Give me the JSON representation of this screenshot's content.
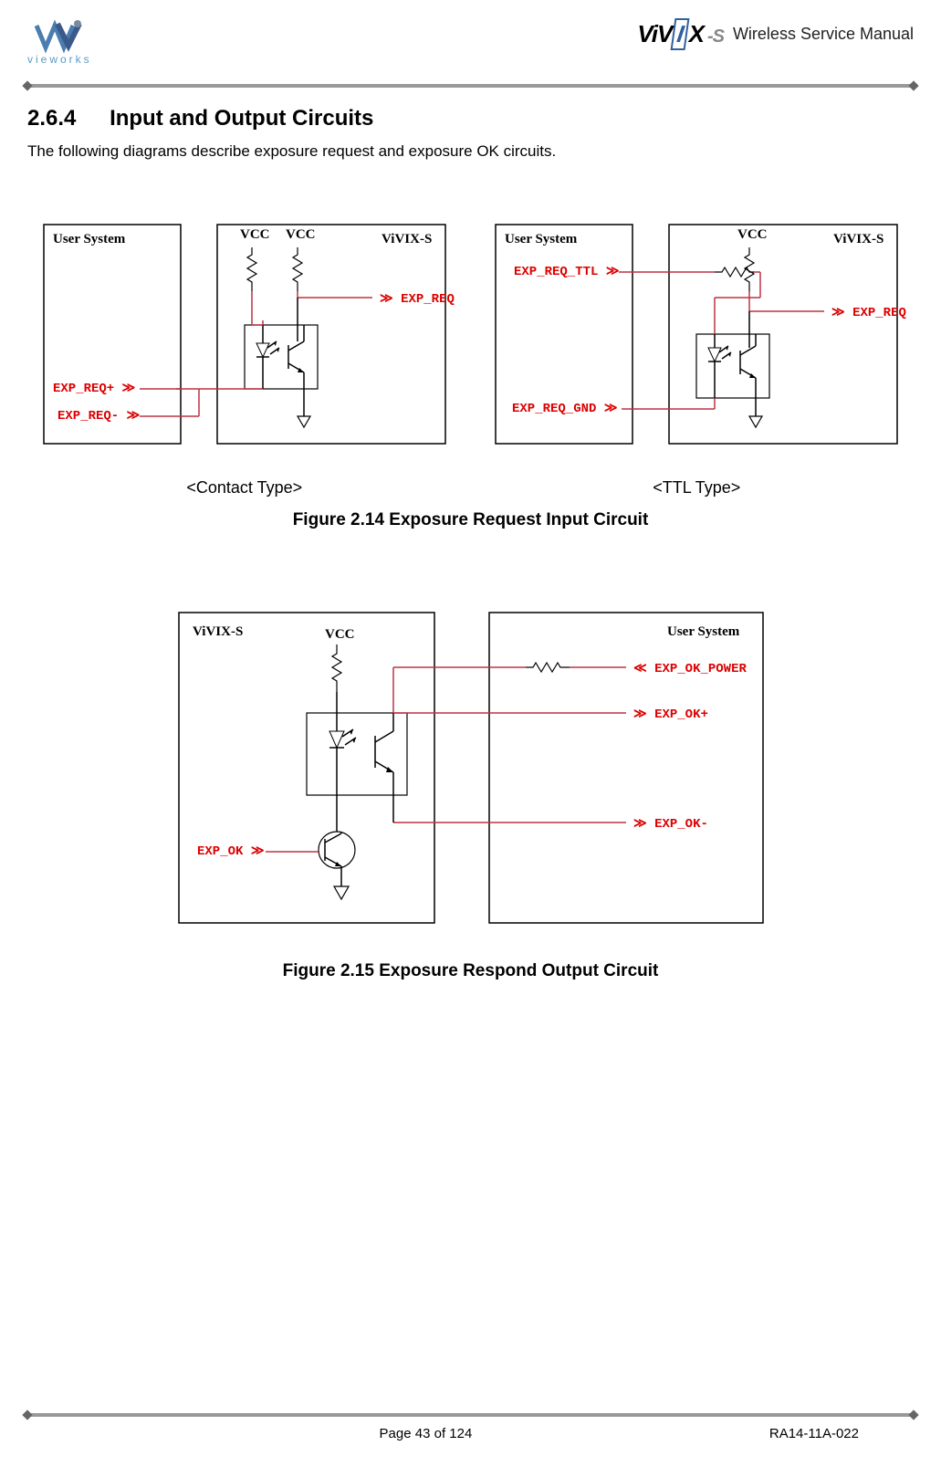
{
  "header": {
    "brand_text": "vieworks",
    "product_logo": "ViVIX",
    "product_suffix": "-S",
    "doc_title": "Wireless Service Manual"
  },
  "section": {
    "number": "2.6.4",
    "title": "Input and Output Circuits",
    "intro": "The following diagrams describe exposure request and exposure OK circuits."
  },
  "figure214": {
    "left": {
      "user_system": "User System",
      "vivix": "ViVIX-S",
      "vcc1": "VCC",
      "vcc2": "VCC",
      "exp_req": "EXP_REQ",
      "exp_req_plus": "EXP_REQ+",
      "exp_req_minus": "EXP_REQ-",
      "caption": "<Contact Type>"
    },
    "right": {
      "user_system": "User System",
      "vivix": "ViVIX-S",
      "vcc": "VCC",
      "exp_req_ttl": "EXP_REQ_TTL",
      "exp_req": "EXP_REQ",
      "exp_req_gnd": "EXP_REQ_GND",
      "caption": "<TTL Type>"
    },
    "title": "Figure 2.14   Exposure Request Input Circuit"
  },
  "figure215": {
    "vivix": "ViVIX-S",
    "user_system": "User System",
    "vcc": "VCC",
    "exp_ok": "EXP_OK",
    "exp_ok_power": "EXP_OK_POWER",
    "exp_ok_plus": "EXP_OK+",
    "exp_ok_minus": "EXP_OK-",
    "title": "Figure 2.15   Exposure Respond Output Circuit"
  },
  "footer": {
    "page": "Page 43 of 124",
    "docnum": "RA14-11A-022"
  }
}
